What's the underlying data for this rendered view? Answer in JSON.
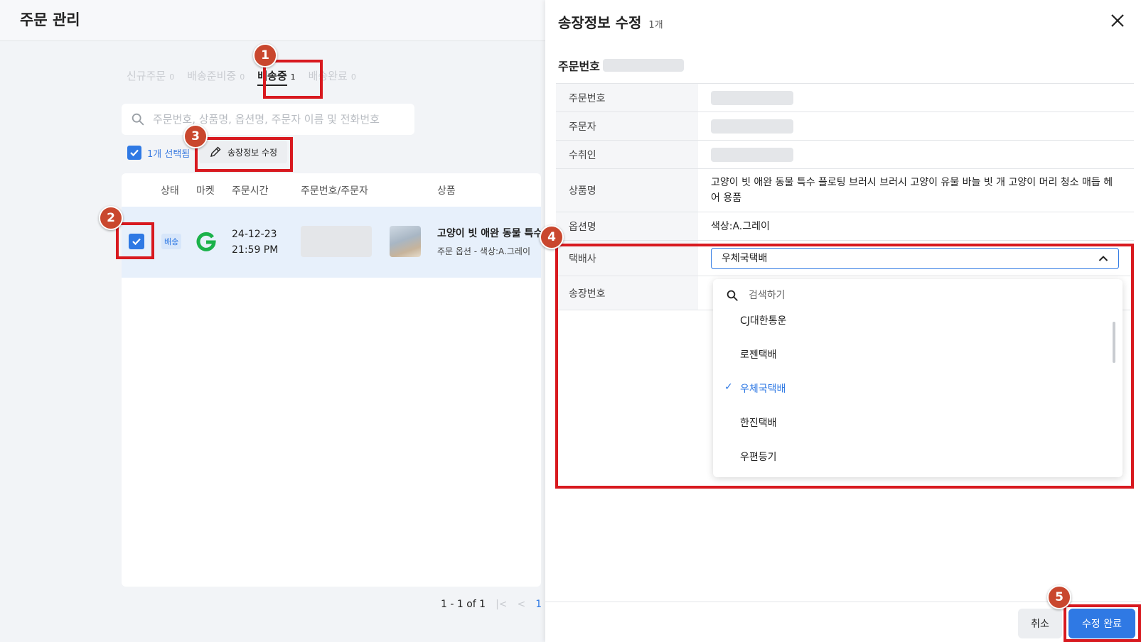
{
  "page": {
    "title": "주문 관리"
  },
  "tabs": [
    {
      "label": "신규주문",
      "count": "0"
    },
    {
      "label": "배송준비중",
      "count": "0"
    },
    {
      "label": "배송중",
      "count": "1"
    },
    {
      "label": "배송완료",
      "count": "0"
    }
  ],
  "search": {
    "placeholder": "주문번호, 상품명, 옵션명, 주문자 이름 및 전화번호"
  },
  "selection": {
    "label": "1개 선택됨",
    "edit_button": "송장정보 수정"
  },
  "table": {
    "headers": [
      "상태",
      "마켓",
      "주문시간",
      "주문번호/주문자",
      "상품"
    ],
    "rows": [
      {
        "status": "배송",
        "market_icon": "g-market-logo",
        "date": "24-12-23",
        "time": "21:59 PM",
        "product_name": "고양이 빗 애완 동물 특수",
        "product_option": "주문 옵션 - 색상:A.그레이"
      }
    ]
  },
  "pagination": {
    "range": "1 - 1 of 1",
    "page": "1"
  },
  "panel": {
    "title": "송장정보 수정",
    "count": "1개",
    "order_no_label": "주문번호",
    "fields": [
      {
        "label": "주문번호"
      },
      {
        "label": "주문자"
      },
      {
        "label": "수취인"
      },
      {
        "label": "상품명",
        "value": "고양이 빗 애완 동물 특수 플로팅 브러시 브러시 고양이 유물 바늘 빗 개 고양이 머리 청소 매듭 헤어 용품"
      },
      {
        "label": "옵션명",
        "value": "색상:A.그레이"
      },
      {
        "label": "택배사",
        "value": "우체국택배"
      },
      {
        "label": "송장번호"
      }
    ],
    "dropdown": {
      "search_placeholder": "검색하기",
      "options": [
        "CJ대한통운",
        "로젠택배",
        "우체국택배",
        "한진택배",
        "우편등기"
      ],
      "selected": "우체국택배"
    },
    "cancel_button": "취소",
    "submit_button": "수정 완료"
  },
  "annotations": [
    "1",
    "2",
    "3",
    "4",
    "5"
  ],
  "colors": {
    "accent": "#2f79e4",
    "highlight": "#d8191f",
    "step_badge": "#c9472e"
  }
}
